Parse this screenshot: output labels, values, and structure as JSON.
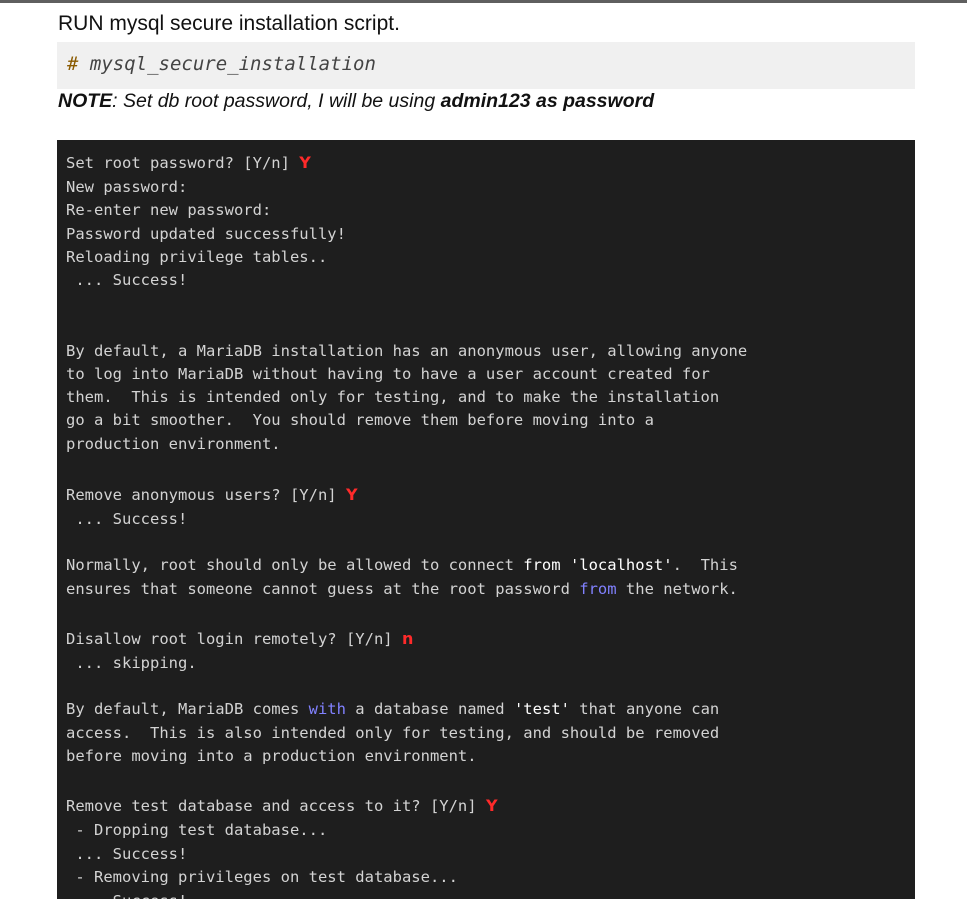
{
  "heading": "RUN mysql secure installation script.",
  "command": {
    "prompt": "#",
    "text": "mysql_secure_installation"
  },
  "note": {
    "label": "NOTE",
    "text": ": Set db root password, I will be using ",
    "emphasis": "admin123 as password"
  },
  "terminal": {
    "q1": "Set root password? [Y/n] ",
    "a1": "Y",
    "l2": "New password:",
    "l3": "Re-enter new password:",
    "l4": "Password updated successfully!",
    "l5": "Reloading privilege tables..",
    "l6": " ... Success!",
    "p1": "By default, a MariaDB installation has an anonymous user, allowing anyone",
    "p2": "to log into MariaDB without having to have a user account created for",
    "p3": "them.  This is intended only for testing, and to make the installation",
    "p4": "go a bit smoother.  You should remove them before moving into a",
    "p5": "production environment.",
    "q2": "Remove anonymous users? [Y/n] ",
    "a2": "Y",
    "s2": " ... Success!",
    "n1a": "Normally, root should only be allowed to connect ",
    "n1b": "from",
    "n1c": " ",
    "n1d": "'localhost'",
    "n1e": ".  This",
    "n2a": "ensures that someone cannot guess at the root password ",
    "n2b": "from",
    "n2c": " the network.",
    "q3": "Disallow root login remotely? [Y/n] ",
    "a3": "n",
    "s3": " ... skipping.",
    "d1a": "By default, MariaDB comes ",
    "d1b": "with",
    "d1c": " a database named ",
    "d1d": "'test'",
    "d1e": " that anyone can",
    "d2": "access.  This is also intended only for testing, and should be removed",
    "d3": "before moving into a production environment.",
    "q4": "Remove test database and access to it? [Y/n] ",
    "a4": "Y",
    "r1": " - Dropping test database...",
    "r2": " ... Success!",
    "r3": " - Removing privileges on test database...",
    "r4": " ... Success!"
  }
}
